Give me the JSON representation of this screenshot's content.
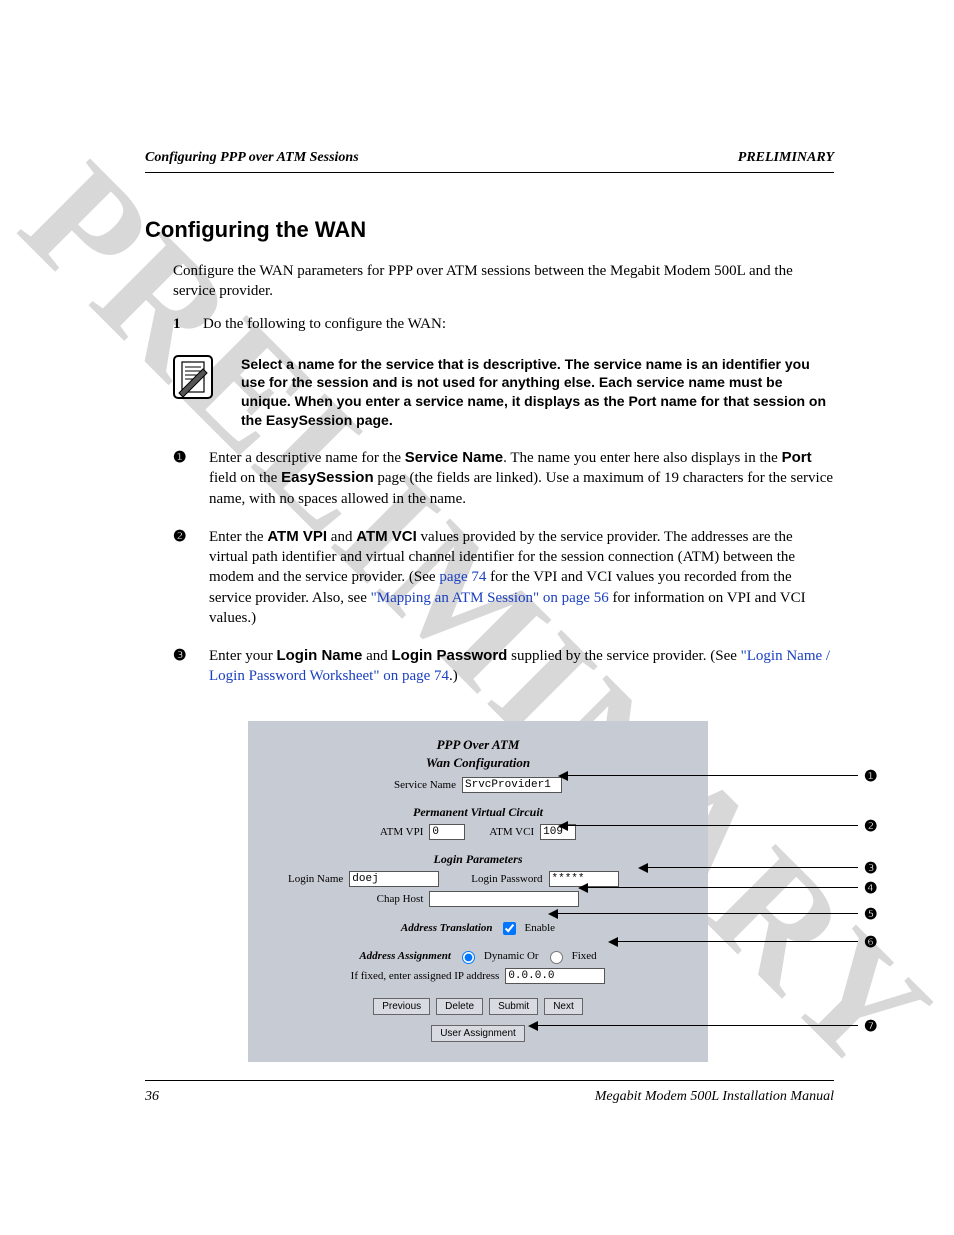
{
  "header": {
    "left": "Configuring PPP over ATM Sessions",
    "right": "PRELIMINARY"
  },
  "watermark": "PRELIMINARY",
  "title": "Configuring the WAN",
  "intro": "Configure the WAN parameters for PPP over ATM sessions between the Megabit Modem 500L and the service provider.",
  "step1_num": "1",
  "step1_text": "Do the following to configure the WAN:",
  "note": "Select a name for the service that is descriptive. The service name is an identifier you use for the session and is not used for anything else. Each service name must be unique. When you enter a service name, it displays as the Port name for that session on the EasySession page.",
  "marks": {
    "m0": "❶",
    "m1": "❷",
    "m2": "❸",
    "m3": "❹",
    "m4": "❺",
    "m5": "❻",
    "m6": "❼"
  },
  "s0a": "Enter a descriptive name for the ",
  "s0b": "Service Name",
  "s0c": ". The name you enter here also displays in the ",
  "s0d": "Port",
  "s0e": " field on the ",
  "s0f": "EasySession",
  "s0g": " page (the fields are linked). Use a maximum of 19 characters for the service name, with no spaces allowed in the name.",
  "s1a": "Enter the ",
  "s1b": "ATM VPI",
  "s1c": " and ",
  "s1d": "ATM VCI",
  "s1e": " values provided by the service provider. The addresses are the virtual path identifier and virtual channel identifier for the session connection (ATM) between the modem and the service provider. (See ",
  "s1f": "page 74",
  "s1g": " for the VPI and VCI values you recorded from the service provider. Also, see ",
  "s1h": "\"Mapping an ATM Session\" on page 56",
  "s1i": " for information on VPI and VCI values.)",
  "s2a": "Enter your ",
  "s2b": "Login Name",
  "s2c": " and ",
  "s2d": "Login Password",
  "s2e": " supplied by the service provider. (See ",
  "s2f": "\"Login Name / Login Password Worksheet\" on page 74",
  "s2g": ".)",
  "form": {
    "title1": "PPP Over ATM",
    "title2": "Wan Configuration",
    "service_label": "Service Name",
    "service_value": "SrvcProvider1",
    "pvc_heading": "Permanent Virtual Circuit",
    "vpi_label": "ATM VPI",
    "vpi_value": "0",
    "vci_label": "ATM VCI",
    "vci_value": "109",
    "login_heading": "Login Parameters",
    "login_name_label": "Login Name",
    "login_name_value": "doej",
    "login_pw_label": "Login Password",
    "login_pw_value": "*****",
    "chap_label": "Chap Host",
    "chap_value": "",
    "addr_trans_label": "Address Translation",
    "enable_label": "Enable",
    "addr_assign_label": "Address Assignment",
    "dynamic_label": "Dynamic Or",
    "fixed_label": "Fixed",
    "fixed_ip_label": "If fixed, enter assigned IP address",
    "fixed_ip_value": "0.0.0.0",
    "btn_prev": "Previous",
    "btn_del": "Delete",
    "btn_submit": "Submit",
    "btn_next": "Next",
    "btn_user": "User Assignment"
  },
  "footer": {
    "page": "36",
    "manual": "Megabit Modem 500L Installation Manual"
  }
}
